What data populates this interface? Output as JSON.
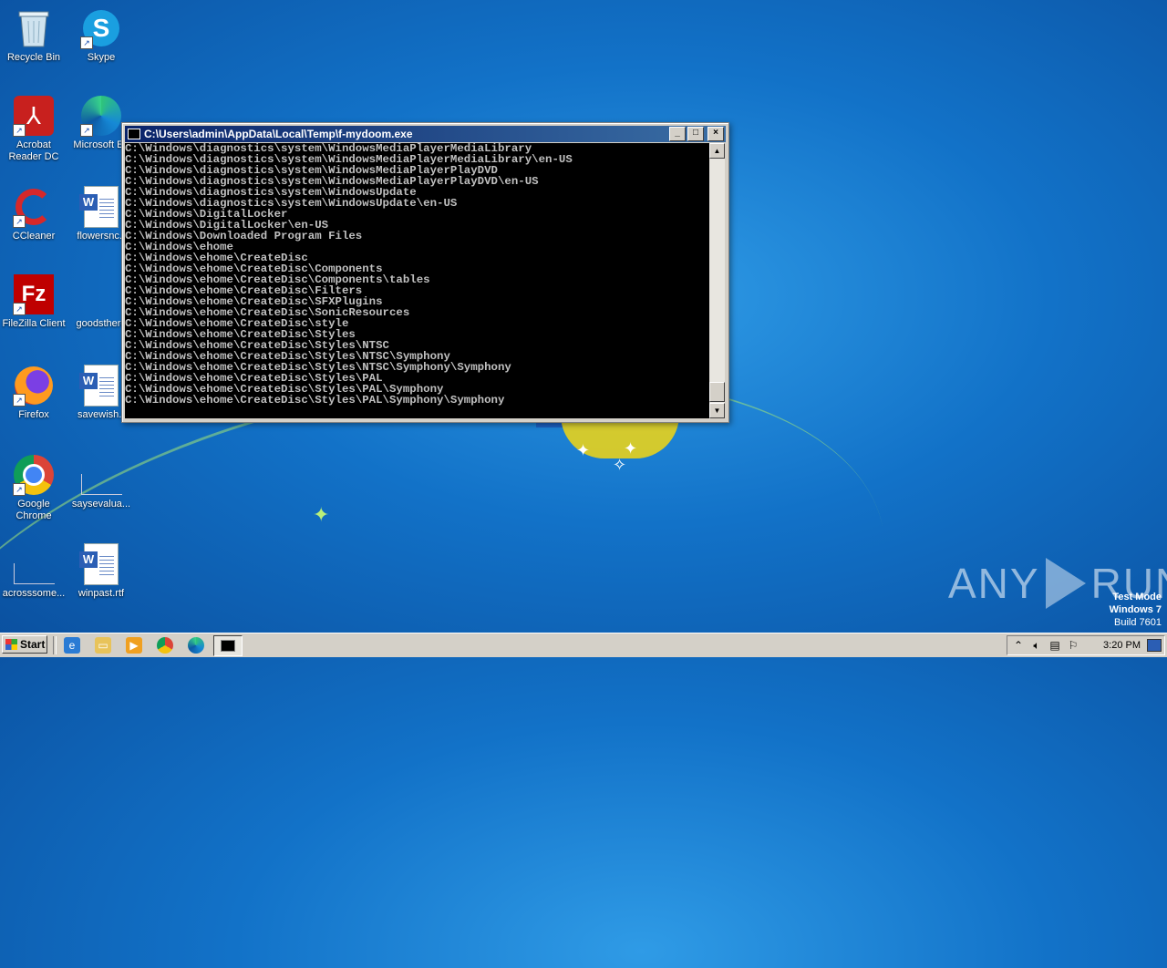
{
  "desktop": {
    "icons": [
      {
        "label": "Recycle Bin"
      },
      {
        "label": "Skype"
      },
      {
        "label": "Acrobat Reader DC"
      },
      {
        "label": "Microsoft Ed"
      },
      {
        "label": "CCleaner"
      },
      {
        "label": "flowersnc.r"
      },
      {
        "label": "FileZilla Client"
      },
      {
        "label": "goodsthere"
      },
      {
        "label": "Firefox"
      },
      {
        "label": "savewish.r"
      },
      {
        "label": "Google Chrome"
      },
      {
        "label": "saysevalua..."
      },
      {
        "label": "acrosssome..."
      },
      {
        "label": "winpast.rtf"
      }
    ]
  },
  "console": {
    "title": "C:\\Users\\admin\\AppData\\Local\\Temp\\f-mydoom.exe",
    "lines": [
      "C:\\Windows\\diagnostics\\system\\WindowsMediaPlayerMediaLibrary",
      "C:\\Windows\\diagnostics\\system\\WindowsMediaPlayerMediaLibrary\\en-US",
      "C:\\Windows\\diagnostics\\system\\WindowsMediaPlayerPlayDVD",
      "C:\\Windows\\diagnostics\\system\\WindowsMediaPlayerPlayDVD\\en-US",
      "C:\\Windows\\diagnostics\\system\\WindowsUpdate",
      "C:\\Windows\\diagnostics\\system\\WindowsUpdate\\en-US",
      "C:\\Windows\\DigitalLocker",
      "C:\\Windows\\DigitalLocker\\en-US",
      "C:\\Windows\\Downloaded Program Files",
      "C:\\Windows\\ehome",
      "C:\\Windows\\ehome\\CreateDisc",
      "C:\\Windows\\ehome\\CreateDisc\\Components",
      "C:\\Windows\\ehome\\CreateDisc\\Components\\tables",
      "C:\\Windows\\ehome\\CreateDisc\\Filters",
      "C:\\Windows\\ehome\\CreateDisc\\SFXPlugins",
      "C:\\Windows\\ehome\\CreateDisc\\SonicResources",
      "C:\\Windows\\ehome\\CreateDisc\\style",
      "C:\\Windows\\ehome\\CreateDisc\\Styles",
      "C:\\Windows\\ehome\\CreateDisc\\Styles\\NTSC",
      "C:\\Windows\\ehome\\CreateDisc\\Styles\\NTSC\\Symphony",
      "C:\\Windows\\ehome\\CreateDisc\\Styles\\NTSC\\Symphony\\Symphony",
      "C:\\Windows\\ehome\\CreateDisc\\Styles\\PAL",
      "C:\\Windows\\ehome\\CreateDisc\\Styles\\PAL\\Symphony",
      "C:\\Windows\\ehome\\CreateDisc\\Styles\\PAL\\Symphony\\Symphony"
    ],
    "buttons": {
      "minimize": "_",
      "maximize": "□",
      "close": "×"
    }
  },
  "watermark": {
    "left": "ANY",
    "right": "RUN"
  },
  "test_mode": {
    "line1": "Test Mode",
    "line2": "Windows 7",
    "line3": "Build 7601"
  },
  "taskbar": {
    "start_label": "Start",
    "clock": "3:20 PM"
  },
  "colors": {
    "desktop_bg": "#1272c8",
    "titlebar": "#0a246a",
    "console_bg": "#000000",
    "console_text": "#c0c0c0"
  }
}
